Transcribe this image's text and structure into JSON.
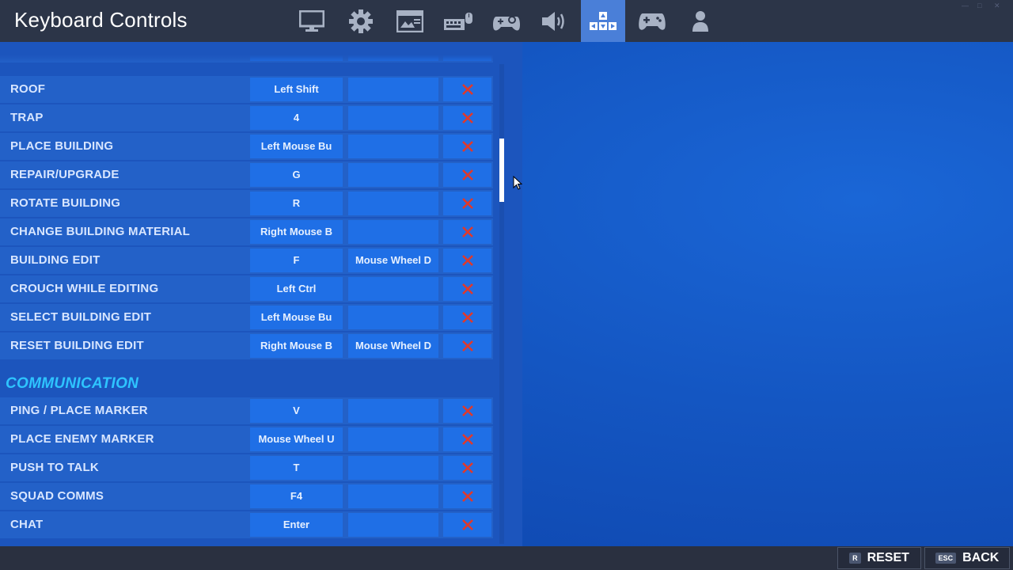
{
  "header": {
    "title": "Keyboard Controls",
    "tabs": [
      {
        "icon": "monitor-icon"
      },
      {
        "icon": "gear-icon"
      },
      {
        "icon": "newspaper-icon"
      },
      {
        "icon": "keyboard-mouse-icon"
      },
      {
        "icon": "controller-settings-icon"
      },
      {
        "icon": "speaker-icon"
      },
      {
        "icon": "keybinds-icon",
        "active": true
      },
      {
        "icon": "gamepad-icon"
      },
      {
        "icon": "account-icon"
      }
    ]
  },
  "bindings": [
    {
      "action": "Roof",
      "primary": "Left Shift",
      "secondary": ""
    },
    {
      "action": "Trap",
      "primary": "4",
      "secondary": ""
    },
    {
      "action": "Place Building",
      "primary": "Left Mouse Bu",
      "secondary": ""
    },
    {
      "action": "Repair/Upgrade",
      "primary": "G",
      "secondary": ""
    },
    {
      "action": "Rotate Building",
      "primary": "R",
      "secondary": ""
    },
    {
      "action": "Change Building Material",
      "primary": "Right Mouse B",
      "secondary": ""
    },
    {
      "action": "Building Edit",
      "primary": "F",
      "secondary": "Mouse Wheel D"
    },
    {
      "action": "Crouch While Editing",
      "primary": "Left Ctrl",
      "secondary": ""
    },
    {
      "action": "Select Building Edit",
      "primary": "Left Mouse Bu",
      "secondary": ""
    },
    {
      "action": "Reset Building Edit",
      "primary": "Right Mouse B",
      "secondary": "Mouse Wheel D"
    }
  ],
  "communication": {
    "heading": "COMMUNICATION",
    "bindings": [
      {
        "action": "Ping / Place Marker",
        "primary": "V",
        "secondary": ""
      },
      {
        "action": "Place Enemy Marker",
        "primary": "Mouse Wheel U",
        "secondary": ""
      },
      {
        "action": "Push to Talk",
        "primary": "T",
        "secondary": ""
      },
      {
        "action": "Squad Comms",
        "primary": "F4",
        "secondary": ""
      },
      {
        "action": "Chat",
        "primary": "Enter",
        "secondary": ""
      }
    ]
  },
  "footer": {
    "reset": {
      "key": "R",
      "label": "RESET"
    },
    "back": {
      "key": "ESC",
      "label": "BACK"
    }
  },
  "colors": {
    "accent_active_tab": "#4a7fd8",
    "section_heading": "#2ec4ff",
    "clear_x": "#e0392b"
  }
}
